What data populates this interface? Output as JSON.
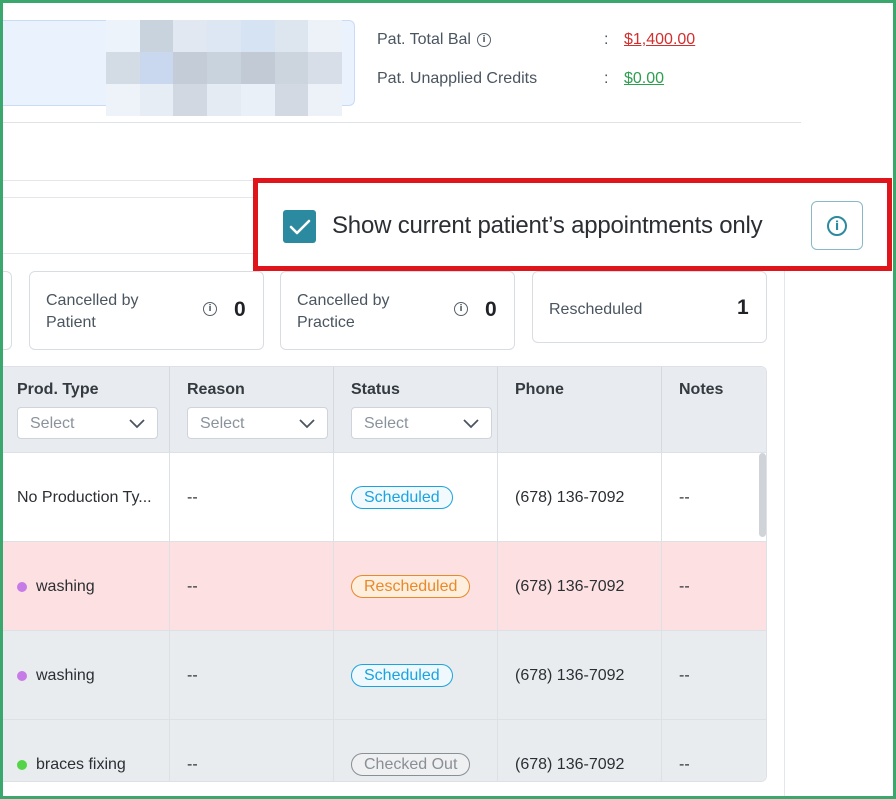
{
  "header": {
    "total_bal_label": "Pat. Total Bal",
    "total_bal_value": "$1,400.00",
    "unapplied_label": "Pat. Unapplied Credits",
    "unapplied_value": "$0.00",
    "colon": ":"
  },
  "filter": {
    "checkbox_label": "Show current patient’s appointments only",
    "checked": true
  },
  "stats": [
    {
      "label": "Cancelled by Patient",
      "value": "0"
    },
    {
      "label": "Cancelled by Practice",
      "value": "0"
    },
    {
      "label": "Rescheduled",
      "value": "1"
    }
  ],
  "table": {
    "columns": [
      {
        "title": "Prod. Type",
        "placeholder": "Select"
      },
      {
        "title": "Reason",
        "placeholder": "Select"
      },
      {
        "title": "Status",
        "placeholder": "Select"
      },
      {
        "title": "Phone"
      },
      {
        "title": "Notes"
      }
    ],
    "rows": [
      {
        "prod_type": "No Production Ty...",
        "reason": "--",
        "status": "Scheduled",
        "phone": "(678) 136-7092",
        "notes": "--"
      },
      {
        "prod_type": "washing",
        "reason": "--",
        "status": "Rescheduled",
        "phone": "(678) 136-7092",
        "notes": "--"
      },
      {
        "prod_type": "washing",
        "reason": "--",
        "status": "Scheduled",
        "phone": "(678) 136-7092",
        "notes": "--"
      },
      {
        "prod_type": "braces fixing",
        "reason": "--",
        "status": "Checked Out",
        "phone": "(678) 136-7092",
        "notes": "--"
      }
    ]
  },
  "colors": {
    "accent": "#2c8aa0",
    "highlight": "#e0151b",
    "balance_negative": "#d32f2f",
    "balance_positive": "#2e9e4f",
    "scheduled": "#1ba3e0",
    "rescheduled": "#e8892a",
    "checked_out": "#8a8f94",
    "rescheduled_row": "#fde0e2",
    "dot_purple": "#c77be6",
    "dot_green": "#55d44a"
  },
  "icons": [
    "info-icon",
    "checkmark-icon",
    "chevron-down-icon"
  ]
}
